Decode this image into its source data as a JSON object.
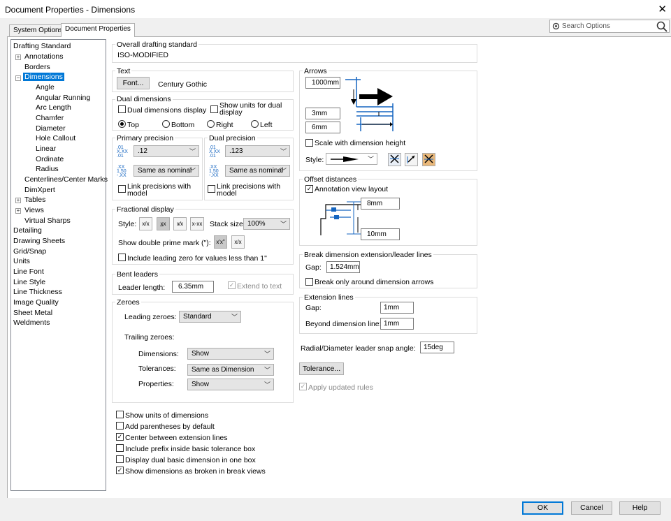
{
  "window": {
    "title": "Document Properties - Dimensions"
  },
  "tabs": [
    "System Options",
    "Document Properties"
  ],
  "search": {
    "placeholder": "Search Options"
  },
  "tree": {
    "items": [
      "Drafting Standard",
      "Annotations",
      "Borders",
      "Dimensions",
      "Angle",
      "Angular Running",
      "Arc Length",
      "Chamfer",
      "Diameter",
      "Hole Callout",
      "Linear",
      "Ordinate",
      "Radius",
      "Centerlines/Center Marks",
      "DimXpert",
      "Tables",
      "Views",
      "Virtual Sharps",
      "Detailing",
      "Drawing Sheets",
      "Grid/Snap",
      "Units",
      "Line Font",
      "Line Style",
      "Line Thickness",
      "Image Quality",
      "Sheet Metal",
      "Weldments"
    ],
    "selected": "Dimensions"
  },
  "drafting": {
    "label": "Overall drafting standard",
    "value": "ISO-MODIFIED"
  },
  "text": {
    "label": "Text",
    "font_button": "Font...",
    "font_name": "Century Gothic"
  },
  "dual": {
    "label": "Dual dimensions",
    "display": "Dual dimensions display",
    "show_units": "Show units for dual display",
    "top": "Top",
    "bottom": "Bottom",
    "right": "Right",
    "left": "Left"
  },
  "primary_precision": {
    "label": "Primary precision",
    "value": ".12",
    "tol": "Same as nominal",
    "link": "Link precisions with model"
  },
  "dual_precision": {
    "label": "Dual precision",
    "value": ".123",
    "tol": "Same as nominal",
    "link": "Link precisions with model"
  },
  "fractional": {
    "label": "Fractional display",
    "style": "Style:",
    "stack_size": "Stack size:",
    "stack_value": "100%",
    "double_prime": "Show double prime mark (\"):",
    "leading_zero": "Include leading zero for values less than 1\""
  },
  "bent": {
    "label": "Bent leaders",
    "length_label": "Leader length:",
    "length_value": "6.35mm",
    "extend": "Extend to text"
  },
  "zeroes": {
    "label": "Zeroes",
    "leading": "Leading zeroes:",
    "leading_value": "Standard",
    "trailing": "Trailing zeroes:",
    "dimensions": "Dimensions:",
    "dimensions_value": "Show",
    "tolerances": "Tolerances:",
    "tolerances_value": "Same as Dimension",
    "properties": "Properties:",
    "properties_value": "Show"
  },
  "options": [
    {
      "label": "Show units of dimensions",
      "checked": false
    },
    {
      "label": "Add parentheses by default",
      "checked": false
    },
    {
      "label": "Center between extension lines",
      "checked": true
    },
    {
      "label": "Include prefix inside basic tolerance box",
      "checked": false
    },
    {
      "label": "Display dual basic dimension in one box",
      "checked": false
    },
    {
      "label": "Show dimensions as broken in break views",
      "checked": true
    }
  ],
  "arrows": {
    "label": "Arrows",
    "v1": "1000mm",
    "v2": "3mm",
    "v3": "6mm",
    "scale": "Scale with dimension height",
    "style": "Style:"
  },
  "offset": {
    "label": "Offset distances",
    "annotation": "Annotation view layout",
    "v1": "8mm",
    "v2": "10mm"
  },
  "break": {
    "label": "Break dimension extension/leader lines",
    "gap": "Gap:",
    "gap_value": "1.524mm",
    "only": "Break only around dimension arrows"
  },
  "extension": {
    "label": "Extension lines",
    "gap": "Gap:",
    "gap_value": "1mm",
    "beyond": "Beyond dimension line:",
    "beyond_value": "1mm"
  },
  "radial": {
    "label": "Radial/Diameter leader snap angle:",
    "value": "15deg"
  },
  "tolerance_button": "Tolerance...",
  "apply_updated": "Apply updated rules",
  "footer": {
    "ok": "OK",
    "cancel": "Cancel",
    "help": "Help"
  },
  "check_mark": "✓"
}
